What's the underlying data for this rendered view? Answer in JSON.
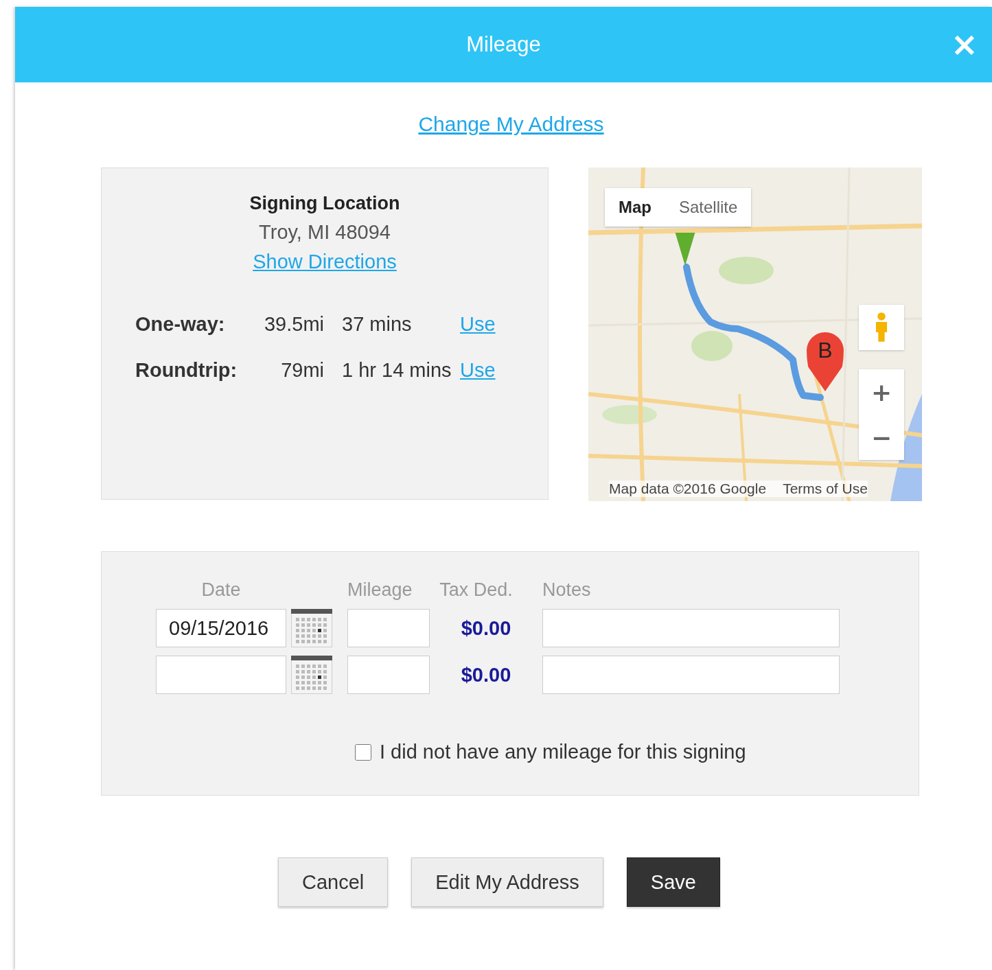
{
  "dialog": {
    "title": "Mileage",
    "close": "×"
  },
  "change_address_link": "Change My Address",
  "location": {
    "heading": "Signing Location",
    "address": "Troy, MI 48094",
    "directions_link": "Show Directions",
    "routes": [
      {
        "label": "One-way:",
        "distance": "39.5mi",
        "duration": "37 mins",
        "action": "Use"
      },
      {
        "label": "Roundtrip:",
        "distance": "79mi",
        "duration": "1 hr 14 mins",
        "action": "Use"
      }
    ]
  },
  "map": {
    "marker_label": "B",
    "types": [
      {
        "label": "Map",
        "selected": true
      },
      {
        "label": "Satellite",
        "selected": false
      }
    ],
    "zoom_in": "+",
    "zoom_out": "−",
    "attribution": "Map data ©2016 Google",
    "terms": "Terms of Use"
  },
  "entries": {
    "columns": [
      "Date",
      "Mileage",
      "Tax Ded.",
      "Notes"
    ],
    "rows": [
      {
        "date": "09/15/2016",
        "tax_deduction": "$0.00"
      },
      {
        "tax_deduction": "$0.00"
      }
    ]
  },
  "no_mileage": {
    "label": "I did not have any mileage for this signing",
    "checked": false
  },
  "buttons": [
    {
      "label": "Cancel",
      "kind": "secondary"
    },
    {
      "label": "Edit My Address",
      "kind": "secondary"
    },
    {
      "label": "Save",
      "kind": "primary"
    }
  ]
}
